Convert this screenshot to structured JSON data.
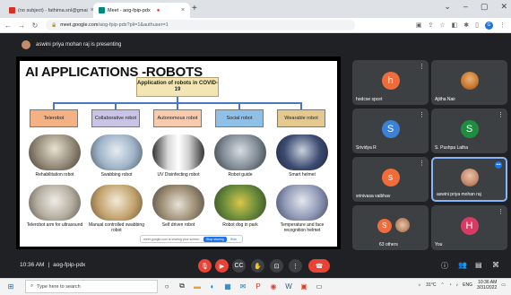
{
  "browser": {
    "tabs": [
      {
        "label": "(no subject) - fathima.snl@gmai",
        "active": false,
        "color": "#d93025"
      },
      {
        "label": "Meet - aog-fpip-pdx",
        "active": true,
        "color": "#00897b"
      }
    ],
    "url_host": "meet.google.com",
    "url_path": "/aog-fpip-pdx?pli=1&authuser=1",
    "profile_initial": "G"
  },
  "meet": {
    "presenter_text": "aswini priya mohan raj is presenting",
    "time": "10:36 AM",
    "meeting_code": "aog-fpip-pdx",
    "participants": [
      {
        "name": "hodcse spcet",
        "initial": "h",
        "color": "#f06c3a"
      },
      {
        "name": "Ajitha Nair",
        "initial": "",
        "color": "#c9772e"
      },
      {
        "name": "Srividya R",
        "initial": "S",
        "color": "#3b82d6"
      },
      {
        "name": "S. Pushpa Latha",
        "initial": "S",
        "color": "#1e8e3e"
      },
      {
        "name": "srinivasa vaibhav",
        "initial": "s",
        "color": "#f06c3a"
      },
      {
        "name": "aswini priya mohan raj",
        "initial": "",
        "color": "#c58a6a"
      },
      {
        "name": "63 others",
        "initial": "S",
        "color": "#f06c3a"
      },
      {
        "name": "You",
        "initial": "H",
        "color": "#d93a63"
      }
    ],
    "share_notice": "meet.google.com is sharing your screen.",
    "stop_sharing": "Stop sharing",
    "hide": "Hide"
  },
  "slide": {
    "title": "AI APPLICATIONS -ROBOTS",
    "root": "Application of robots in COVID-19",
    "categories": [
      {
        "label": "Telerobot",
        "bg": "#f4b183"
      },
      {
        "label": "Collaborative robot",
        "bg": "#c9c3e6"
      },
      {
        "label": "Autonomous robot",
        "bg": "#f8cbad"
      },
      {
        "label": "Social robot",
        "bg": "#8fc0e8"
      },
      {
        "label": "Wearable robot",
        "bg": "#e3c98e"
      }
    ],
    "photos_row1": [
      "Rehabilitation robot",
      "Swabbing robot",
      "UV Disinfecting robot",
      "Robot guide",
      "Smart helmet"
    ],
    "photos_row2": [
      "Telerobot arm for ultrasound",
      "Manual controlled swabbing robot",
      "Self driven robot",
      "Robot dog in park",
      "Temperature and face recognition helmet"
    ]
  },
  "taskbar": {
    "search_placeholder": "Type here to search",
    "weather": "31°C",
    "lang": "ENG",
    "time": "10:36 AM",
    "date": "3/31/2022"
  }
}
